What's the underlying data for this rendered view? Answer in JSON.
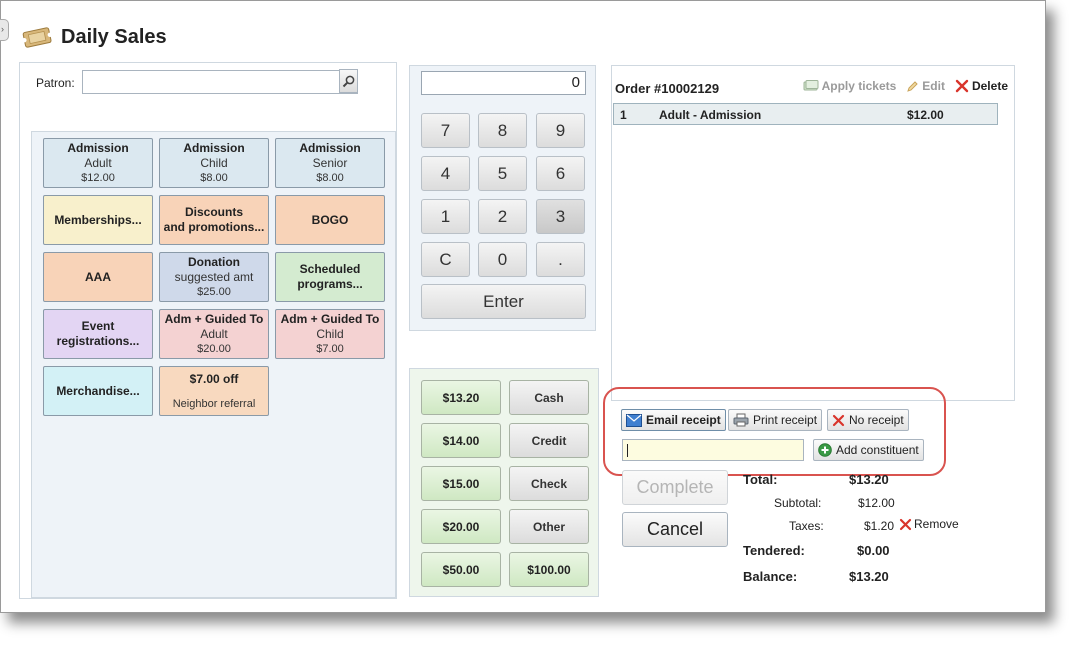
{
  "window": {
    "title": "Daily Sales"
  },
  "patron": {
    "label": "Patron:",
    "value": ""
  },
  "products": [
    {
      "line1": "Admission",
      "line2": "",
      "sub": "Adult",
      "price": "$12.00",
      "color": "#dbe8f0"
    },
    {
      "line1": "Admission",
      "line2": "",
      "sub": "Child",
      "price": "$8.00",
      "color": "#dbe8f0"
    },
    {
      "line1": "Admission",
      "line2": "",
      "sub": "Senior",
      "price": "$8.00",
      "color": "#dbe8f0"
    },
    {
      "line1": "Memberships...",
      "line2": "",
      "sub": "",
      "price": "",
      "color": "#f8f0cc"
    },
    {
      "line1": "Discounts",
      "line2": "and promotions...",
      "sub": "",
      "price": "",
      "color": "#f8d3b8"
    },
    {
      "line1": "BOGO",
      "line2": "",
      "sub": "",
      "price": "",
      "color": "#f8d3b8"
    },
    {
      "line1": "AAA",
      "line2": "",
      "sub": "",
      "price": "",
      "color": "#f8d3b8"
    },
    {
      "line1": "Donation",
      "line2": "",
      "sub": "suggested amt",
      "price": "$25.00",
      "color": "#cfd9ea"
    },
    {
      "line1": "Scheduled",
      "line2": "programs...",
      "sub": "",
      "price": "",
      "color": "#d4ebd0"
    },
    {
      "line1": "Event",
      "line2": "registrations...",
      "sub": "",
      "price": "",
      "color": "#e3d5f3"
    },
    {
      "line1": "Adm + Guided To",
      "line2": "",
      "sub": "Adult",
      "price": "$20.00",
      "color": "#f4d2d2"
    },
    {
      "line1": "Adm + Guided To",
      "line2": "",
      "sub": "Child",
      "price": "$7.00",
      "color": "#f4d2d2"
    },
    {
      "line1": "Merchandise...",
      "line2": "",
      "sub": "",
      "price": "",
      "color": "#d3f1f6"
    },
    {
      "line1": "$7.00 off",
      "line2": "",
      "sub": "",
      "price": "Neighbor referral",
      "color": "#f8d9bf"
    }
  ],
  "keypad": {
    "display": "0",
    "keys": [
      "7",
      "8",
      "9",
      "4",
      "5",
      "6",
      "1",
      "2",
      "3",
      "C",
      "0",
      "."
    ],
    "enter": "Enter"
  },
  "payment": {
    "amounts": [
      "$13.20",
      "$14.00",
      "$15.00",
      "$20.00",
      "$50.00"
    ],
    "types": [
      "Cash",
      "Credit",
      "Check",
      "Other",
      "$100.00"
    ]
  },
  "order": {
    "title": "Order #10002129",
    "apply_tickets": "Apply tickets",
    "edit": "Edit",
    "delete": "Delete",
    "items": [
      {
        "qty": "1",
        "name": "Adult - Admission",
        "price": "$12.00"
      }
    ]
  },
  "receipt": {
    "email": "Email receipt",
    "print": "Print receipt",
    "none": "No receipt",
    "add_constituent": "Add constituent",
    "constituent_value": ""
  },
  "actions": {
    "complete": "Complete",
    "cancel": "Cancel"
  },
  "totals": {
    "total_label": "Total:",
    "total": "$13.20",
    "subtotal_label": "Subtotal:",
    "subtotal": "$12.00",
    "taxes_label": "Taxes:",
    "taxes": "$1.20",
    "remove": "Remove",
    "tendered_label": "Tendered:",
    "tendered": "$0.00",
    "balance_label": "Balance:",
    "balance": "$13.20"
  },
  "colors": {
    "highlight": "#d9534f",
    "delete_x": "#d9342b"
  }
}
